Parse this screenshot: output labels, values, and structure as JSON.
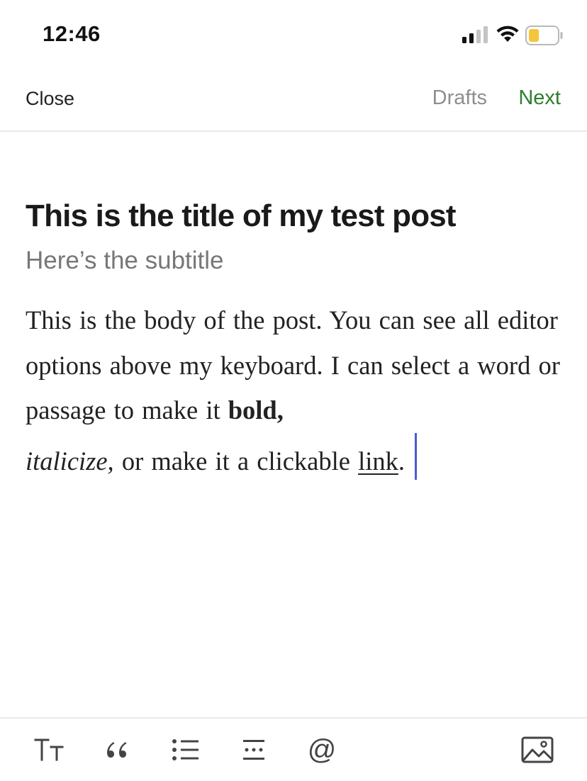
{
  "status_bar": {
    "time": "12:46",
    "icons": [
      "cellular-signal-icon",
      "wifi-icon",
      "battery-low-icon"
    ],
    "battery_color": "#f4c63d"
  },
  "nav": {
    "close_label": "Close",
    "drafts_label": "Drafts",
    "next_label": "Next",
    "next_color": "#2e7d2e"
  },
  "post": {
    "title": "This is the title of my test post",
    "subtitle": "Here’s the subtitle",
    "body": {
      "part1": "This is the body of the post. You can see all editor options above my keyboard. I can select a word or passage to make it ",
      "bold": "bold,",
      "italic": "italicize,",
      "part2": " or make it a clickable ",
      "link": "link",
      "part3": "."
    },
    "cursor_color": "#4a5bd1"
  },
  "toolbar": {
    "tools": [
      {
        "name": "text-size-icon",
        "glyph": "Tт"
      },
      {
        "name": "quote-icon",
        "glyph": "“"
      },
      {
        "name": "bulleted-list-icon"
      },
      {
        "name": "separator-icon"
      },
      {
        "name": "mention-icon",
        "glyph": "@"
      },
      {
        "name": "image-icon"
      }
    ]
  }
}
